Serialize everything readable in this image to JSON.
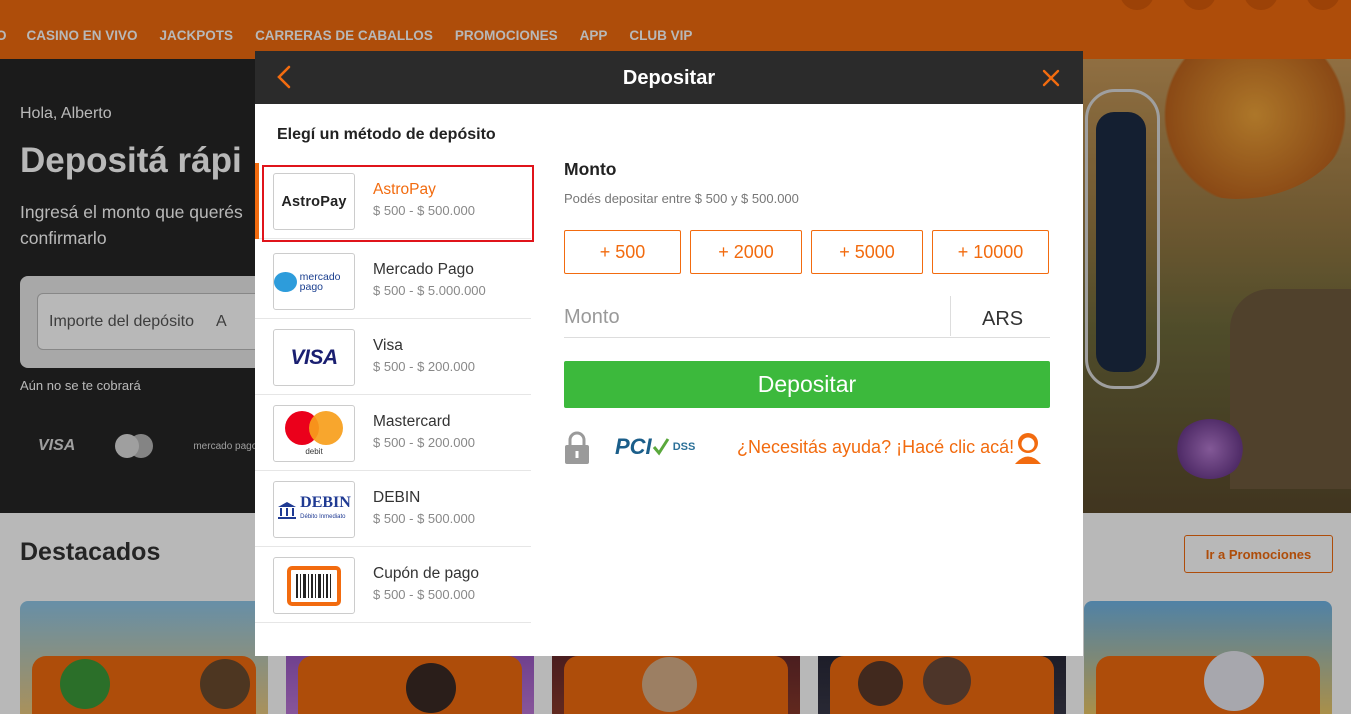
{
  "nav": {
    "items": [
      "O",
      "CASINO EN VIVO",
      "JACKPOTS",
      "CARRERAS DE CABALLOS",
      "PROMOCIONES",
      "APP",
      "CLUB VIP"
    ]
  },
  "hero": {
    "greeting": "Hola, Alberto",
    "headline": "Depositá rápi",
    "subtitle": "Ingresá el monto que querés confirmarlo",
    "deposit_input_placeholder": "Importe del depósito",
    "deposit_input_suffix": "A",
    "no_charge_note": "Aún no se te cobrará",
    "pay_icons": {
      "visa": "VISA",
      "mercadopago": "mercado pago"
    }
  },
  "section": {
    "title": "Destacados",
    "promo_button": "Ir a Promociones"
  },
  "modal": {
    "title": "Depositar",
    "back_icon": "chevron-left-icon",
    "close_icon": "close-icon",
    "choose_label": "Elegí un método de depósito",
    "methods": [
      {
        "name": "AstroPay",
        "range": "$ 500 - $ 500.000",
        "logo": "AstroPay",
        "selected": true
      },
      {
        "name": "Mercado Pago",
        "range": "$ 500 - $ 5.000.000",
        "logo": "mercado pago"
      },
      {
        "name": "Visa",
        "range": "$ 500 - $ 200.000",
        "logo": "VISA"
      },
      {
        "name": "Mastercard",
        "range": "$ 500 - $ 200.000",
        "logo": "debit"
      },
      {
        "name": "DEBIN",
        "range": "$ 500 - $ 500.000",
        "logo": "DEBIN",
        "logo_sub": "Débito Inmediato"
      },
      {
        "name": "Cupón de pago",
        "range": "$ 500 - $ 500.000",
        "logo": "barcode"
      }
    ],
    "amount": {
      "title": "Monto",
      "subtitle": "Podés depositar entre $ 500 y $ 500.000",
      "quick": [
        "+ 500",
        "+ 2000",
        "+ 5000",
        "+ 10000"
      ],
      "placeholder": "Monto",
      "currency": "ARS",
      "submit": "Depositar",
      "pci_text": "PCI",
      "pci_dss": "DSS",
      "help": "¿Necesitás ayuda? ¡Hacé clic acá!"
    }
  },
  "colors": {
    "accent": "#f26b0f",
    "green": "#3cb93c",
    "header": "#2b2b2b",
    "selection": "#e0141b"
  }
}
